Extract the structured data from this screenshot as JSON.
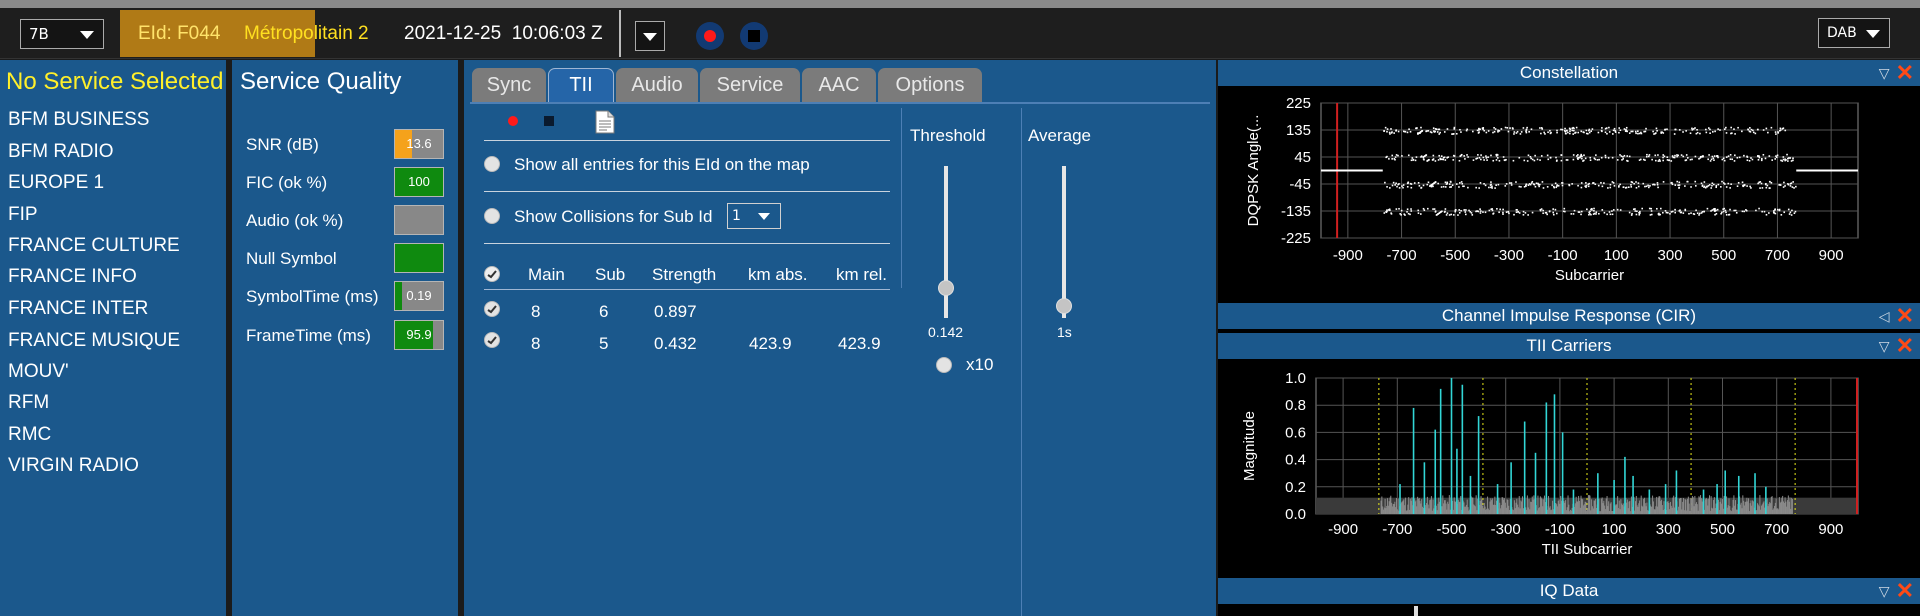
{
  "toolbar": {
    "channel": "7B",
    "eid": "EId: F044",
    "ensemble_name": "Métropolitain 2",
    "datetime": "2021-12-25  10:06:03 Z",
    "mode": "DAB"
  },
  "services": {
    "title": "No Service Selected",
    "items": [
      "BFM BUSINESS",
      "BFM RADIO",
      "EUROPE 1",
      "FIP",
      "FRANCE CULTURE",
      "FRANCE INFO",
      "FRANCE INTER",
      "FRANCE MUSIQUE",
      "MOUV'",
      "RFM",
      "RMC",
      "VIRGIN RADIO"
    ]
  },
  "quality": {
    "title": "Service Quality",
    "items": [
      {
        "label": "SNR (dB)",
        "value": "13.6",
        "fill": 0.35,
        "color": "#f5a21b"
      },
      {
        "label": "FIC (ok %)",
        "value": "100",
        "fill": 1.0,
        "color": "#0f8a0f"
      },
      {
        "label": "Audio (ok %)",
        "value": "",
        "fill": 0.0,
        "color": "#0f8a0f"
      },
      {
        "label": "Null Symbol",
        "value": "",
        "fill": 1.0,
        "color": "#0f8a0f"
      },
      {
        "label": "SymbolTime (ms)",
        "value": "0.19",
        "fill": 0.15,
        "color": "#0f8a0f"
      },
      {
        "label": "FrameTime (ms)",
        "value": "95.9",
        "fill": 0.8,
        "color": "#0f8a0f"
      }
    ]
  },
  "tabs": [
    "Sync",
    "TII",
    "Audio",
    "Service",
    "AAC",
    "Options"
  ],
  "tii": {
    "show_all": "Show all entries for this EId on the map",
    "show_collisions": "Show Collisions for Sub Id",
    "sub_id": "1",
    "columns": [
      "Main",
      "Sub",
      "Strength",
      "km abs.",
      "km rel."
    ],
    "rows": [
      {
        "main": "8",
        "sub": "6",
        "strength": "0.897",
        "abs": "",
        "rel": ""
      },
      {
        "main": "8",
        "sub": "5",
        "strength": "0.432",
        "abs": "423.9",
        "rel": "423.9"
      }
    ],
    "threshold_label": "Threshold",
    "threshold_value": "0.142",
    "x10_label": "x10",
    "average_label": "Average",
    "average_value": "1s"
  },
  "docks": {
    "constellation": "Constellation",
    "cir": "Channel Impulse Response (CIR)",
    "tii_carriers": "TII Carriers",
    "iq": "IQ Data"
  },
  "constellation_axes": {
    "ylabel": "DQPSK  Angle(...",
    "xlabel": "Subcarrier",
    "yticks": [
      "225",
      "135",
      "45",
      "-45",
      "-135",
      "-225"
    ],
    "xticks": [
      "-900",
      "-700",
      "-500",
      "-300",
      "-100",
      "100",
      "300",
      "500",
      "700",
      "900"
    ]
  },
  "tii_axes": {
    "ylabel": "Magnitude",
    "xlabel": "TII Subcarrier",
    "yticks": [
      "1.0",
      "0.8",
      "0.6",
      "0.4",
      "0.2",
      "0.0"
    ],
    "xticks": [
      "-900",
      "-700",
      "-500",
      "-300",
      "-100",
      "100",
      "300",
      "500",
      "700",
      "900"
    ]
  },
  "colors": {
    "panel": "#1b588c",
    "ensemble": "#b07a16",
    "accent": "#ffef2a",
    "close": "#ff4a16",
    "cyan": "#32d6d6"
  }
}
